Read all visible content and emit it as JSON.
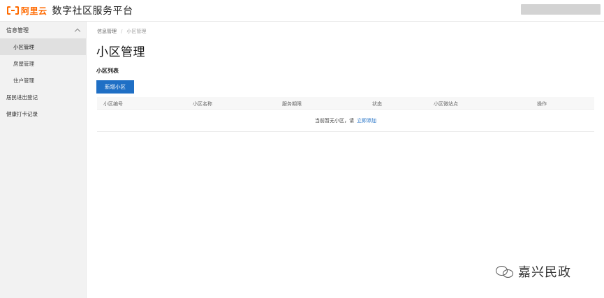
{
  "header": {
    "logo_text": "阿里云",
    "app_title": "数字社区服务平台"
  },
  "sidebar": {
    "group_label": "信息管理",
    "items": [
      {
        "label": "小区管理",
        "active": true
      },
      {
        "label": "房屋管理",
        "active": false
      },
      {
        "label": "住户管理",
        "active": false
      }
    ],
    "top_items": [
      {
        "label": "居民进出登记"
      },
      {
        "label": "健康打卡记录"
      }
    ]
  },
  "main": {
    "breadcrumb": {
      "parent": "信息管理",
      "separator": "/",
      "current": "小区管理"
    },
    "page_title": "小区管理",
    "section_title": "小区列表",
    "add_button_label": "新增小区",
    "table": {
      "columns": [
        "小区编号",
        "小区名称",
        "服务期限",
        "状态",
        "小区微站点",
        "操作"
      ],
      "empty_text": "当前暂无小区，请",
      "empty_link": "立即添加"
    }
  },
  "watermark": {
    "text": "嘉兴民政"
  },
  "colors": {
    "brand": "#ff6a00",
    "primary": "#1f6fc5"
  }
}
